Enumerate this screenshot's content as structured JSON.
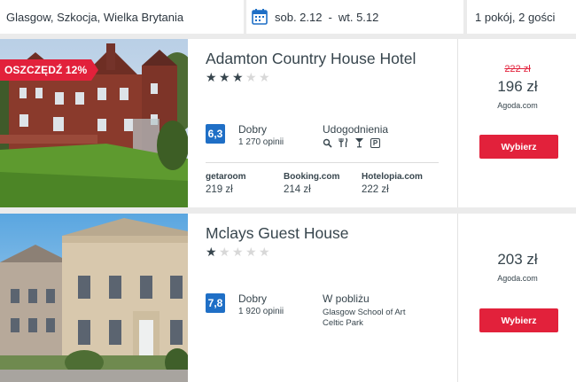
{
  "search": {
    "destination": "Glasgow, Szkocja, Wielka Brytania",
    "checkin": "sob. 2.12",
    "separator": "-",
    "checkout": "wt. 5.12",
    "guests": "1 pokój, 2 gości"
  },
  "results": [
    {
      "discount_badge": "OSZCZĘDŹ 12%",
      "name": "Adamton Country House Hotel",
      "stars": 3,
      "score": "6,3",
      "rating_word": "Dobry",
      "review_count": "1 270 opinii",
      "amenities_title": "Udogodnienia",
      "amenities": [
        "spa-icon",
        "restaurant-icon",
        "bar-icon",
        "parking-icon"
      ],
      "parking_letter": "P",
      "deals": [
        {
          "name": "getaroom",
          "price": "219 zł"
        },
        {
          "name": "Booking.com",
          "price": "214 zł"
        },
        {
          "name": "Hotelopia.com",
          "price": "222 zł"
        }
      ],
      "old_price": "222 zł",
      "price": "196 zł",
      "provider": "Agoda.com",
      "button": "Wybierz"
    },
    {
      "name": "Mclays Guest House",
      "stars": 1,
      "score": "7,8",
      "rating_word": "Dobry",
      "review_count": "1 920 opinii",
      "nearby_title": "W pobliżu",
      "nearby": [
        "Glasgow School of Art",
        "Celtic Park"
      ],
      "price": "203 zł",
      "provider": "Agoda.com",
      "button": "Wybierz"
    }
  ],
  "colors": {
    "accent": "#e2213b",
    "score": "#1f6fc6",
    "text": "#37454d",
    "date_icon": "#1f6fc6"
  }
}
